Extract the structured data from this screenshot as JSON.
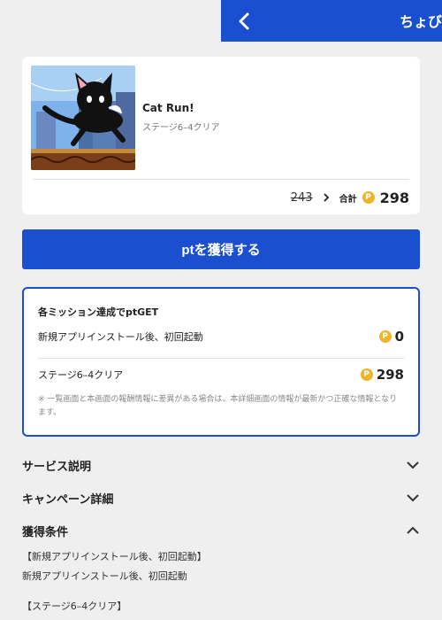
{
  "header": {
    "title": "ちょび"
  },
  "app": {
    "name": "Cat Run!",
    "subtitle": "ステージ6–4クリア",
    "old_pt": "243",
    "total_label": "合計",
    "total_pt": "298"
  },
  "coin_glyph": "P",
  "cta_label": "ptを獲得する",
  "mission": {
    "title": "各ミッション達成でptGET",
    "rows": [
      {
        "label": "新規アプリインストール後、初回起動",
        "pt": "0"
      },
      {
        "label": "ステージ6–4クリア",
        "pt": "298"
      }
    ],
    "note": "※ 一覧画面と本画面の報酬情報に差異がある場合は、本詳細画面の情報が最新かつ正確な情報となります。"
  },
  "accordions": [
    {
      "title": "サービス説明",
      "state": "collapsed"
    },
    {
      "title": "キャンペーン詳細",
      "state": "collapsed"
    },
    {
      "title": "獲得条件",
      "state": "expanded"
    }
  ],
  "conditions": {
    "heading1": "【新規アプリインストール後、初回起動】",
    "body1": "新規アプリインストール後、初回起動",
    "heading2": "【ステージ6–4クリア】"
  },
  "colors": {
    "brand_blue": "#1a4fd0",
    "coin_gold": "#f0b429",
    "background": "#efefef"
  }
}
